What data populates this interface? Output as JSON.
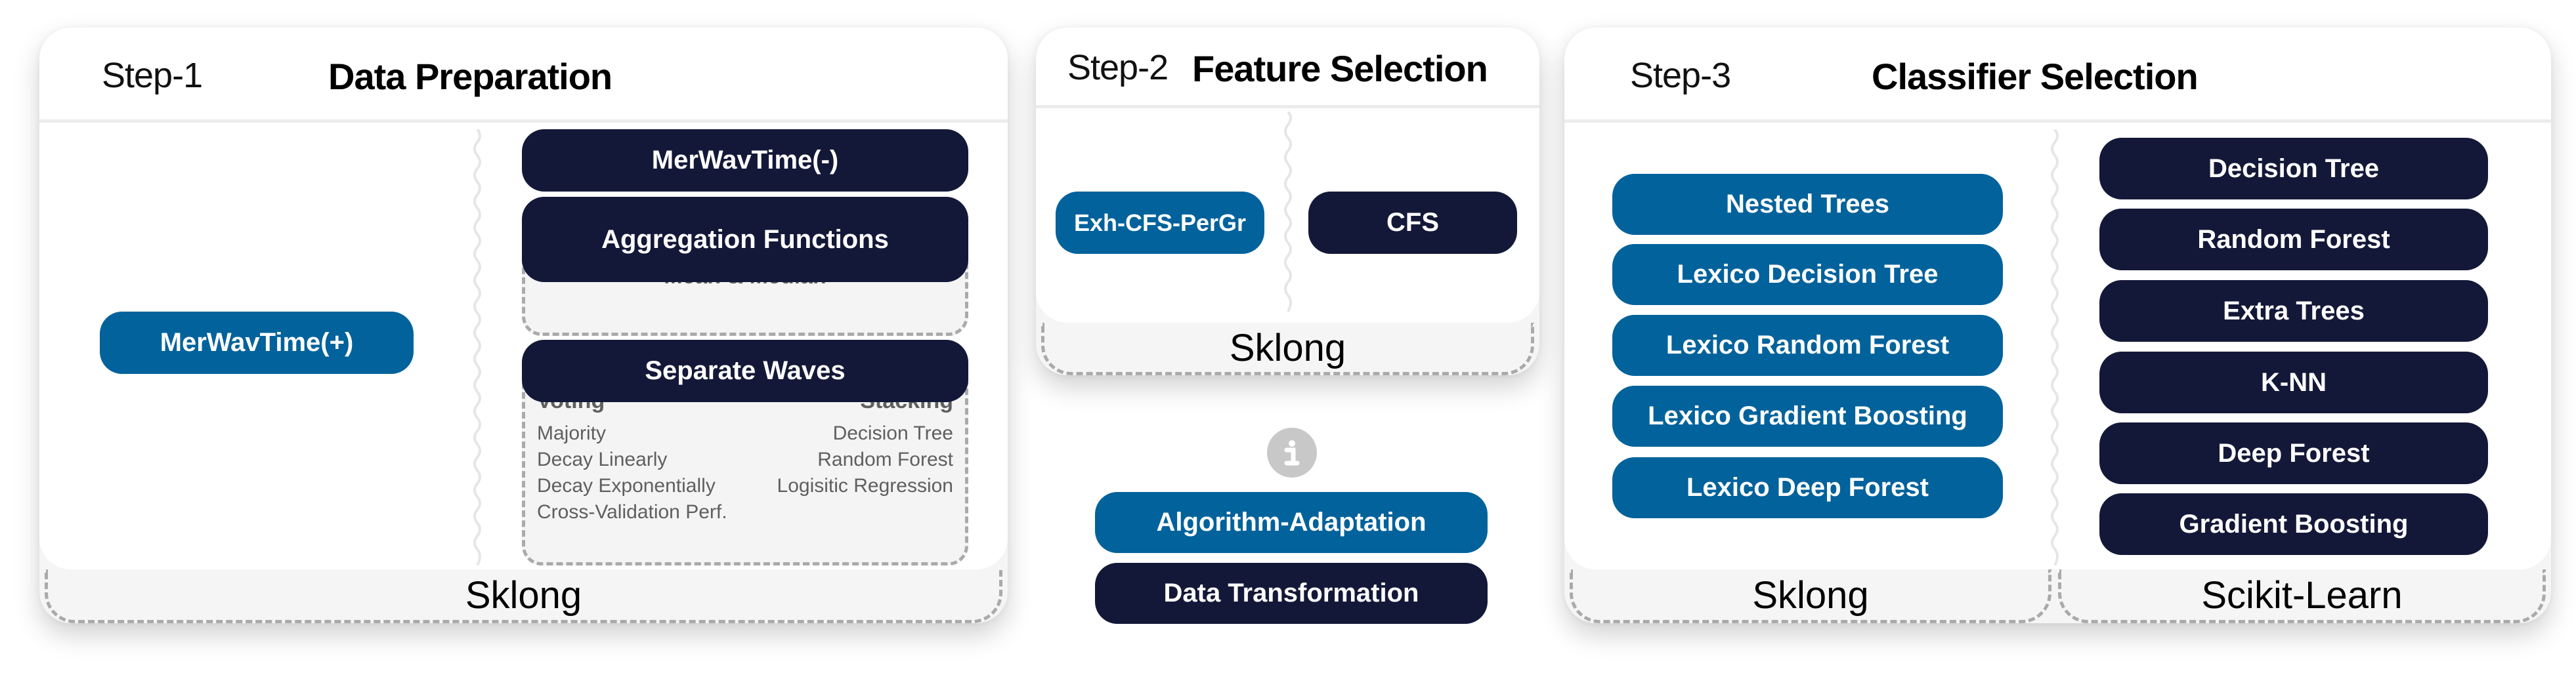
{
  "colors": {
    "algorithm_adaptation": "#02629b",
    "data_transformation": "#141838",
    "panel_footer": "#f5f5f5",
    "info_icon": "#c8c8c8"
  },
  "step1": {
    "step": "Step-1",
    "title": "Data Preparation",
    "left_button": "MerWavTime(+)",
    "right": {
      "merwav_minus": "MerWavTime(-)",
      "aggregation": "Aggregation Functions",
      "aggregation_sub": "Mean & Median",
      "separate_waves": "Separate Waves",
      "voting": {
        "heading": "Voting",
        "items": [
          "Majority",
          "Decay Linearly",
          "Decay Exponentially",
          "Cross-Validation Perf."
        ]
      },
      "stacking": {
        "heading": "Stacking",
        "items": [
          "Decision Tree",
          "Random Forest",
          "Logisitic Regression"
        ]
      }
    },
    "footer": "Sklong"
  },
  "step2": {
    "step": "Step-2",
    "title": "Feature Selection",
    "left_button": "Exh-CFS-PerGr",
    "right_button": "CFS",
    "footer": "Sklong"
  },
  "legend": {
    "icon": "info-icon",
    "items": [
      "Algorithm-Adaptation",
      "Data Transformation"
    ]
  },
  "step3": {
    "step": "Step-3",
    "title": "Classifier Selection",
    "left_buttons": [
      "Nested Trees",
      "Lexico Decision Tree",
      "Lexico Random Forest",
      "Lexico Gradient Boosting",
      "Lexico Deep Forest"
    ],
    "right_buttons": [
      "Decision Tree",
      "Random Forest",
      "Extra Trees",
      "K-NN",
      "Deep Forest",
      "Gradient Boosting"
    ],
    "footer_left": "Sklong",
    "footer_right": "Scikit-Learn"
  }
}
